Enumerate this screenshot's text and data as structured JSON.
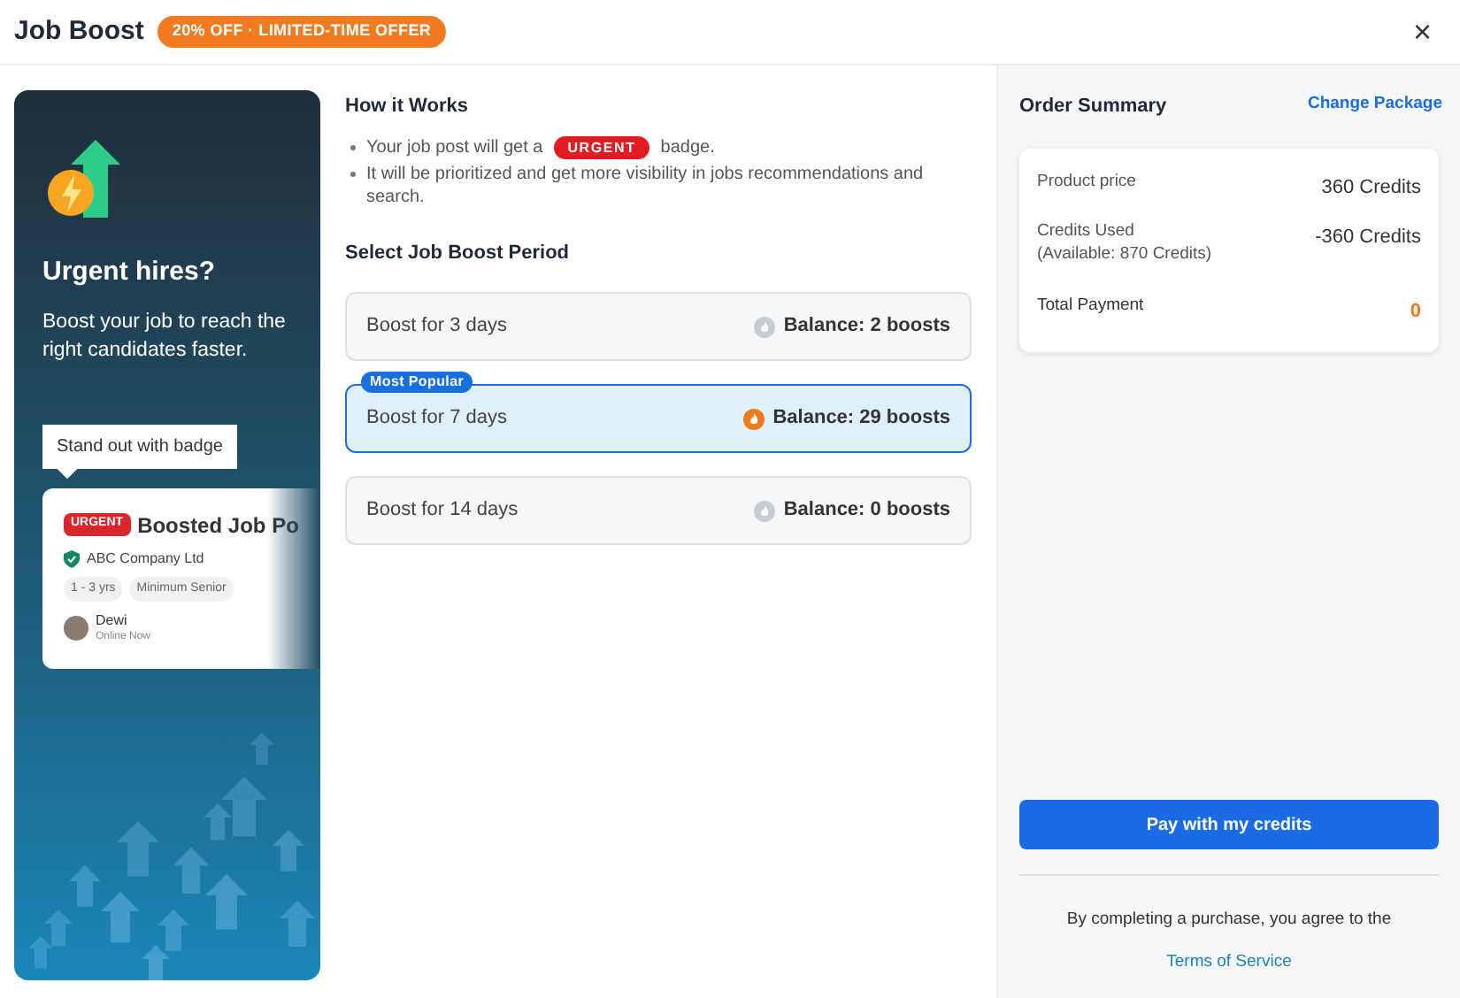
{
  "dialog": {
    "title": "Job Boost",
    "offer_badge": "20% OFF · LIMITED-TIME OFFER",
    "close": "×"
  },
  "promo": {
    "heading": "Urgent hires?",
    "text": "Boost your job to reach the right candidates faster.",
    "tooltip": "Stand out with badge",
    "sample_card": {
      "badge": "URGENT",
      "title": "Boosted Job Po",
      "company": "ABC Company Ltd",
      "tags": [
        "1 - 3 yrs",
        "Minimum Senior"
      ],
      "recruiter": "Dewi",
      "status": "Online Now"
    }
  },
  "how_it_works": {
    "title": "How it Works",
    "bullets": [
      {
        "before": "Your job post will get a",
        "badge": "URGENT",
        "after": "badge."
      },
      {
        "before": "It will be prioritized and get more visibility in jobs recommendations and search."
      }
    ]
  },
  "period": {
    "title": "Select Job Boost Period",
    "options": [
      {
        "label": "Boost for 3 days",
        "balance": "Balance: 2 boosts",
        "selected": false
      },
      {
        "label": "Boost for 7 days",
        "balance": "Balance: 29 boosts",
        "selected": true,
        "tag": "Most Popular"
      },
      {
        "label": "Boost for 14 days",
        "balance": "Balance: 0 boosts",
        "selected": false
      }
    ]
  },
  "order_summary": {
    "title": "Order Summary",
    "change_link": "Change Package",
    "rows": [
      {
        "label": "Product price",
        "value": "360 Credits"
      },
      {
        "label": "Credits Used",
        "note": "(Available: 870 Credits)",
        "value": "-360 Credits"
      },
      {
        "label": "Total Payment",
        "value": "0",
        "kind": "total"
      }
    ],
    "pay_button": "Pay with my credits",
    "terms": "By completing a purchase, you agree to the",
    "terms_link": "Terms of Service"
  }
}
